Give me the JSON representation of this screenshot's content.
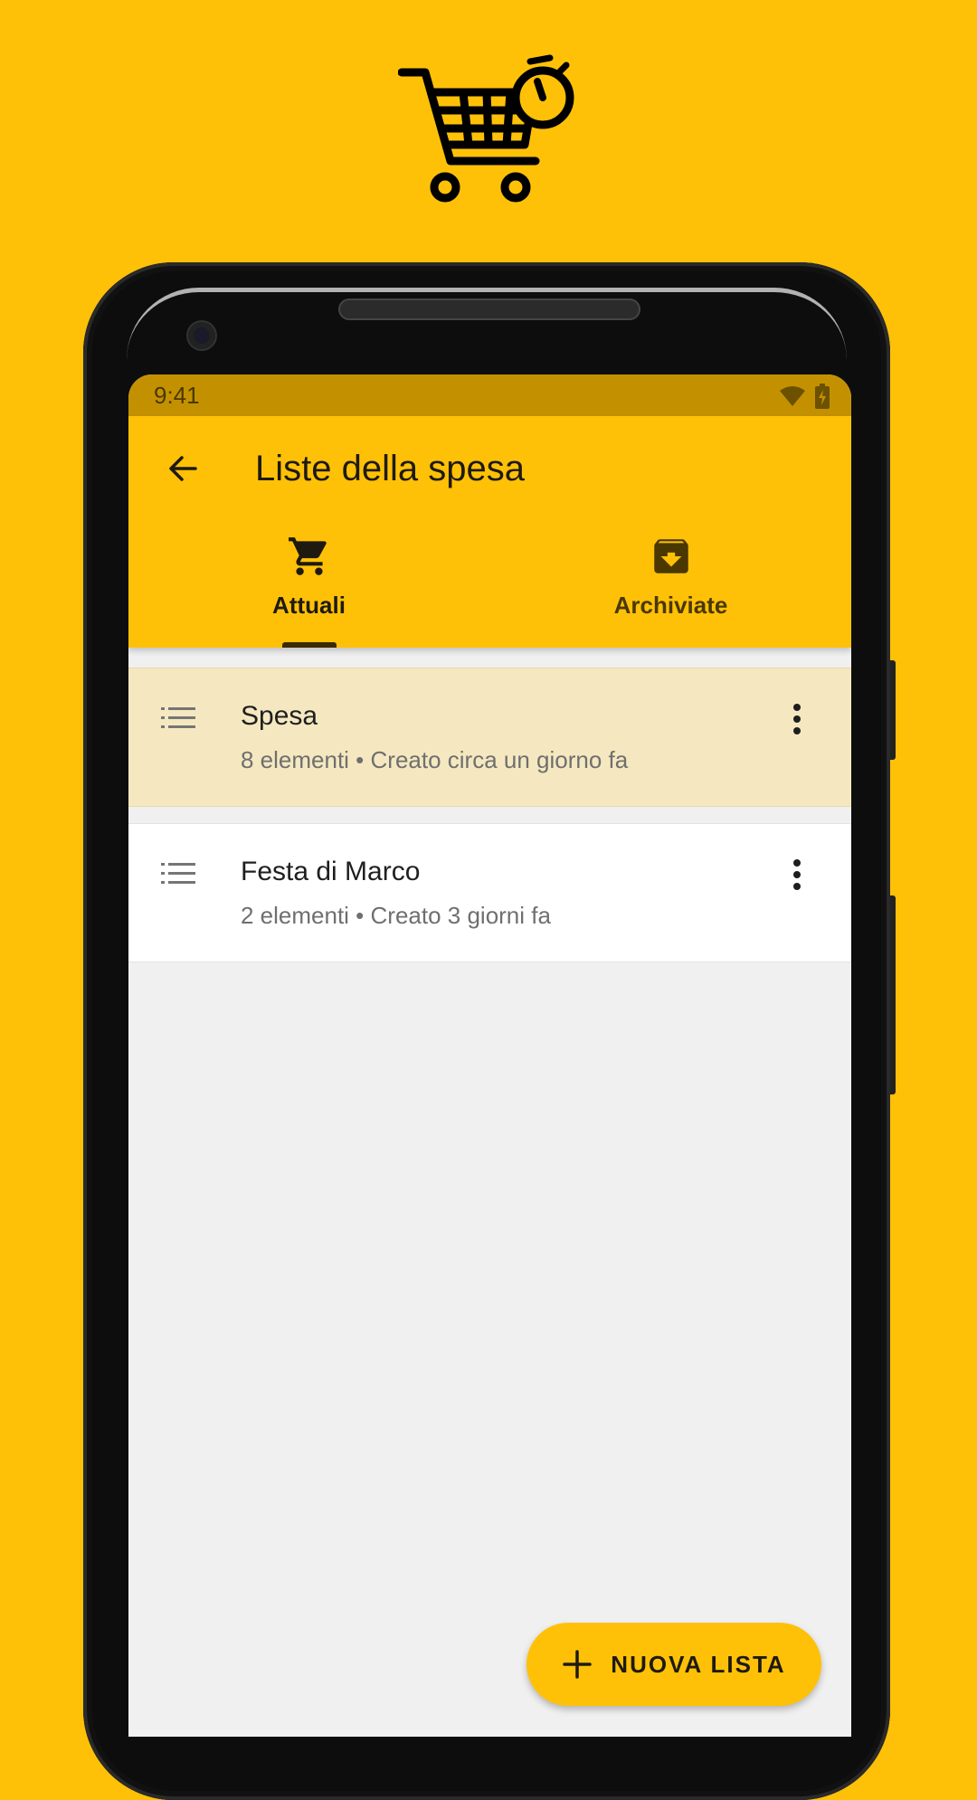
{
  "colors": {
    "brand": "#FFC107",
    "status_bar": "#C39100",
    "selected_row": "#F5E8C0",
    "screen_bg": "#F0F0F0"
  },
  "status_bar": {
    "time": "9:41",
    "icons": [
      "wifi-icon",
      "battery-charging-icon"
    ]
  },
  "app_bar": {
    "back_icon": "arrow-back-icon",
    "title": "Liste della spesa"
  },
  "tabs": [
    {
      "label": "Attuali",
      "icon": "shopping-cart-icon",
      "selected": true
    },
    {
      "label": "Archiviate",
      "icon": "archive-icon",
      "selected": false
    }
  ],
  "lists": [
    {
      "title": "Spesa",
      "subtitle": "8 elementi • Creato circa un giorno fa",
      "selected": true
    },
    {
      "title": "Festa di Marco",
      "subtitle": "2 elementi • Creato 3 giorni fa",
      "selected": false
    }
  ],
  "fab": {
    "label": "NUOVA LISTA",
    "icon": "plus-icon"
  },
  "logo": {
    "icon": "shopping-cart-timer-icon"
  }
}
